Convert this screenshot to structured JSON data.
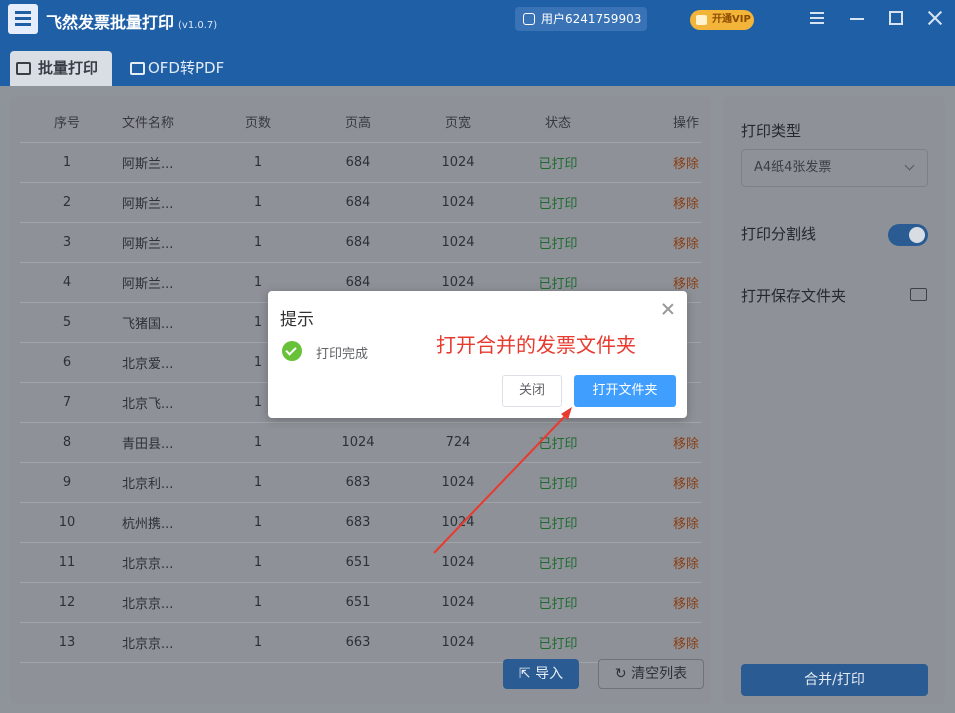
{
  "app": {
    "title": "飞然发票批量打印",
    "version": "(v1.0.7)",
    "user": "用户6241759903",
    "vip_label": "开通VIP"
  },
  "tabs": [
    {
      "label": "批量打印",
      "active": true
    },
    {
      "label": "OFD转PDF",
      "active": false
    }
  ],
  "table": {
    "headers": [
      "序号",
      "文件名称",
      "页数",
      "页高",
      "页宽",
      "状态",
      "操作"
    ],
    "rows": [
      {
        "no": "1",
        "name": "阿斯兰...",
        "pages": "1",
        "height": "684",
        "width": "1024",
        "status": "已打印",
        "action": "移除"
      },
      {
        "no": "2",
        "name": "阿斯兰...",
        "pages": "1",
        "height": "684",
        "width": "1024",
        "status": "已打印",
        "action": "移除"
      },
      {
        "no": "3",
        "name": "阿斯兰...",
        "pages": "1",
        "height": "684",
        "width": "1024",
        "status": "已打印",
        "action": "移除"
      },
      {
        "no": "4",
        "name": "阿斯兰...",
        "pages": "1",
        "height": "684",
        "width": "1024",
        "status": "已打印",
        "action": "移除"
      },
      {
        "no": "5",
        "name": "飞猪国...",
        "pages": "1",
        "height": "",
        "width": "",
        "status": "",
        "action": ""
      },
      {
        "no": "6",
        "name": "北京爱...",
        "pages": "1",
        "height": "",
        "width": "",
        "status": "",
        "action": ""
      },
      {
        "no": "7",
        "name": "北京飞...",
        "pages": "1",
        "height": "",
        "width": "",
        "status": "",
        "action": ""
      },
      {
        "no": "8",
        "name": "青田县...",
        "pages": "1",
        "height": "1024",
        "width": "724",
        "status": "已打印",
        "action": "移除"
      },
      {
        "no": "9",
        "name": "北京利...",
        "pages": "1",
        "height": "683",
        "width": "1024",
        "status": "已打印",
        "action": "移除"
      },
      {
        "no": "10",
        "name": "杭州携...",
        "pages": "1",
        "height": "683",
        "width": "1024",
        "status": "已打印",
        "action": "移除"
      },
      {
        "no": "11",
        "name": "北京京...",
        "pages": "1",
        "height": "651",
        "width": "1024",
        "status": "已打印",
        "action": "移除"
      },
      {
        "no": "12",
        "name": "北京京...",
        "pages": "1",
        "height": "651",
        "width": "1024",
        "status": "已打印",
        "action": "移除"
      },
      {
        "no": "13",
        "name": "北京京...",
        "pages": "1",
        "height": "663",
        "width": "1024",
        "status": "已打印",
        "action": "移除"
      }
    ]
  },
  "buttons": {
    "import": "导入",
    "clear": "清空列表",
    "merge_print": "合并/打印"
  },
  "side": {
    "print_type_label": "打印类型",
    "print_type_value": "A4纸4张发票",
    "split_line_label": "打印分割线",
    "split_line_on": true,
    "open_folder_label": "打开保存文件夹"
  },
  "dialog": {
    "title": "提示",
    "message": "打印完成",
    "cancel": "关闭",
    "confirm": "打开文件夹"
  },
  "annotation": "打开合并的发票文件夹",
  "colors": {
    "brand": "#1f5fa6",
    "primary_button": "#409eff",
    "success": "#67c23a",
    "annotation": "#e83a2f"
  }
}
